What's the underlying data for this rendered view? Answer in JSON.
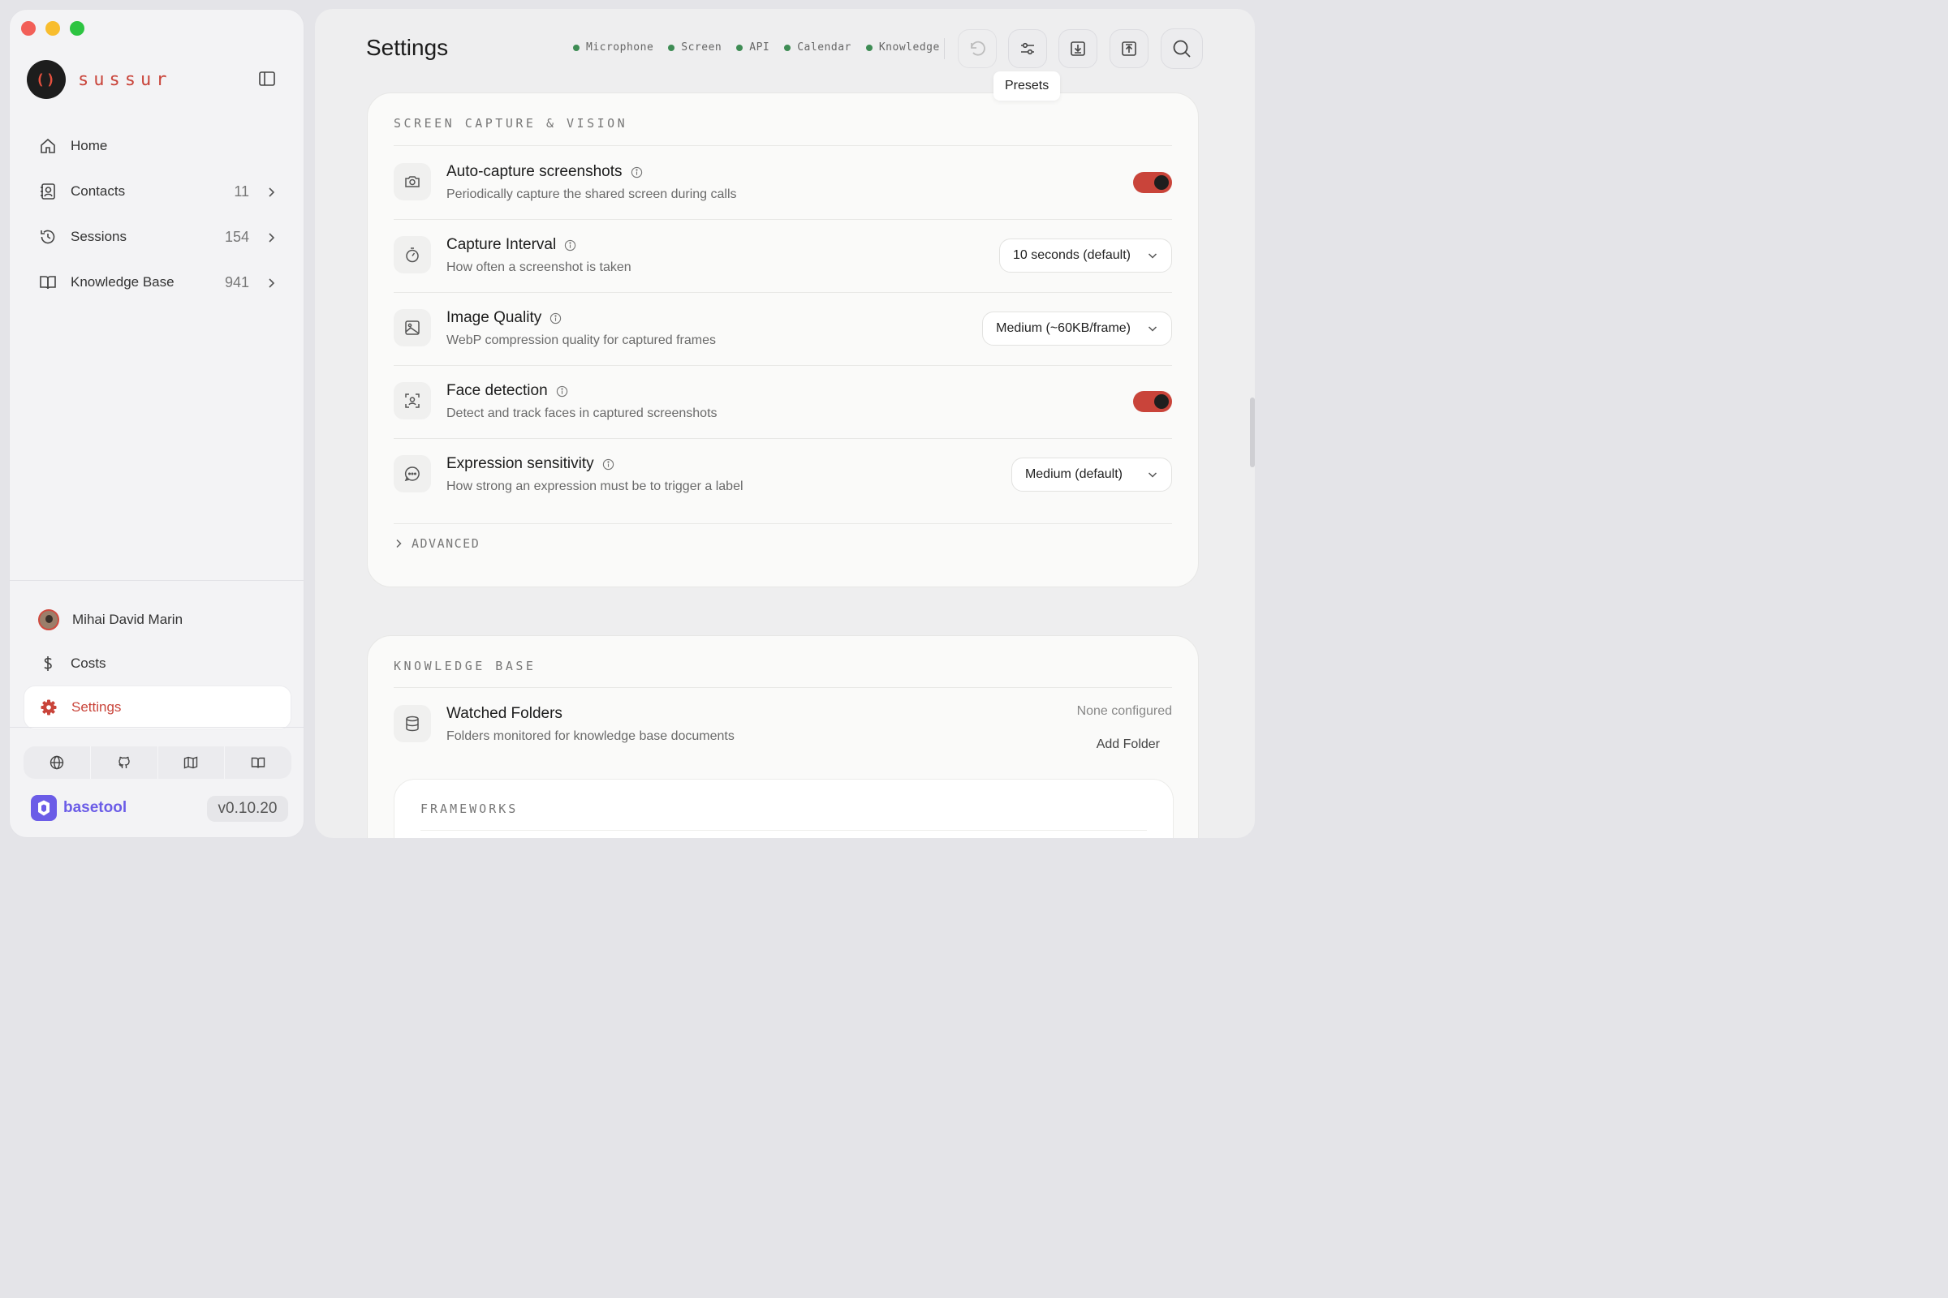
{
  "app": {
    "logo_text": "sussur",
    "logo_mark": "()"
  },
  "sidebar": {
    "items": [
      {
        "label": "Home",
        "icon": "home-icon"
      },
      {
        "label": "Contacts",
        "count": "11",
        "icon": "contacts-icon"
      },
      {
        "label": "Sessions",
        "count": "154",
        "icon": "history-icon"
      },
      {
        "label": "Knowledge Base",
        "count": "941",
        "icon": "book-icon"
      }
    ],
    "user_name": "Mihai David Marin",
    "costs_label": "Costs",
    "settings_label": "Settings",
    "brand": "basetool",
    "version": "v0.10.20"
  },
  "header": {
    "title": "Settings",
    "status": [
      "Microphone",
      "Screen",
      "API",
      "Calendar",
      "Knowledge"
    ],
    "status_color": "#3e8c54",
    "tooltip": "Presets"
  },
  "screen_capture": {
    "title": "SCREEN CAPTURE & VISION",
    "rows": [
      {
        "title": "Auto-capture screenshots",
        "desc": "Periodically capture the shared screen during calls",
        "toggle": true
      },
      {
        "title": "Capture Interval",
        "desc": "How often a screenshot is taken",
        "value": "10 seconds (default)"
      },
      {
        "title": "Image Quality",
        "desc": "WebP compression quality for captured frames",
        "value": "Medium (~60KB/frame)"
      },
      {
        "title": "Face detection",
        "desc": "Detect and track faces in captured screenshots",
        "toggle": true
      },
      {
        "title": "Expression sensitivity",
        "desc": "How strong an expression must be to trigger a label",
        "value": "Medium (default)"
      }
    ],
    "advanced_label": "ADVANCED"
  },
  "knowledge_base": {
    "title": "KNOWLEDGE BASE",
    "watched_title": "Watched Folders",
    "watched_desc": "Folders monitored for knowledge base documents",
    "watched_status": "None configured",
    "add_folder_label": "Add Folder",
    "frameworks_title": "FRAMEWORKS"
  },
  "colors": {
    "accent": "#c9443a",
    "brand": "#6b5ce7"
  }
}
